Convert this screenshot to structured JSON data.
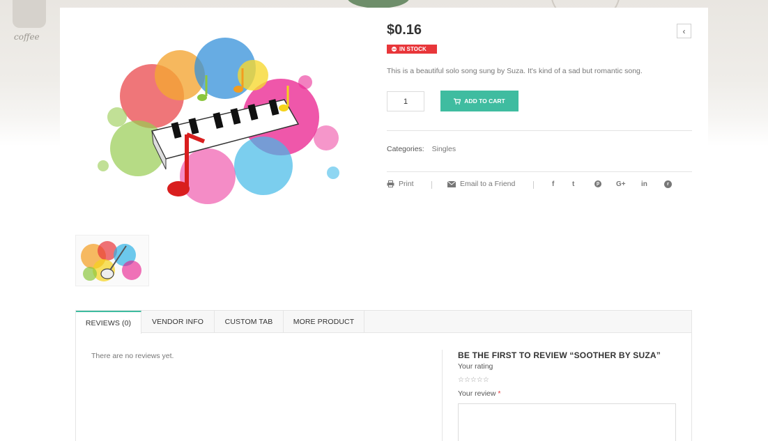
{
  "background": {
    "logo_text": "coffee"
  },
  "product": {
    "price": "$0.16",
    "stock_status": "IN STOCK",
    "description": "This is a beautiful solo song sung by Suza. It's kind of a sad but romantic song.",
    "quantity": "1",
    "add_to_cart_label": "ADD TO CART",
    "categories_label": "Categories:",
    "category": "Singles",
    "main_image_icon": "music-splash-image",
    "thumbnail_icon": "guitar-splash-image"
  },
  "share": {
    "print_label": "Print",
    "email_label": "Email to a Friend",
    "social": [
      "f",
      "t",
      "p",
      "G+",
      "in",
      "r"
    ]
  },
  "tabs": [
    {
      "label": "REVIEWS (0)",
      "active": true
    },
    {
      "label": "VENDOR INFO",
      "active": false
    },
    {
      "label": "CUSTOM TAB",
      "active": false
    },
    {
      "label": "MORE PRODUCT",
      "active": false
    }
  ],
  "reviews": {
    "empty_text": "There are no reviews yet.",
    "form_title": "BE THE FIRST TO REVIEW “SOOTHER BY SUZA”",
    "rating_label": "Your rating",
    "stars": "☆☆☆☆☆",
    "review_label": "Your review",
    "required_mark": "*"
  },
  "colors": {
    "accent": "#3fbca0",
    "stock_badge": "#e8363a",
    "price": "#333333"
  }
}
